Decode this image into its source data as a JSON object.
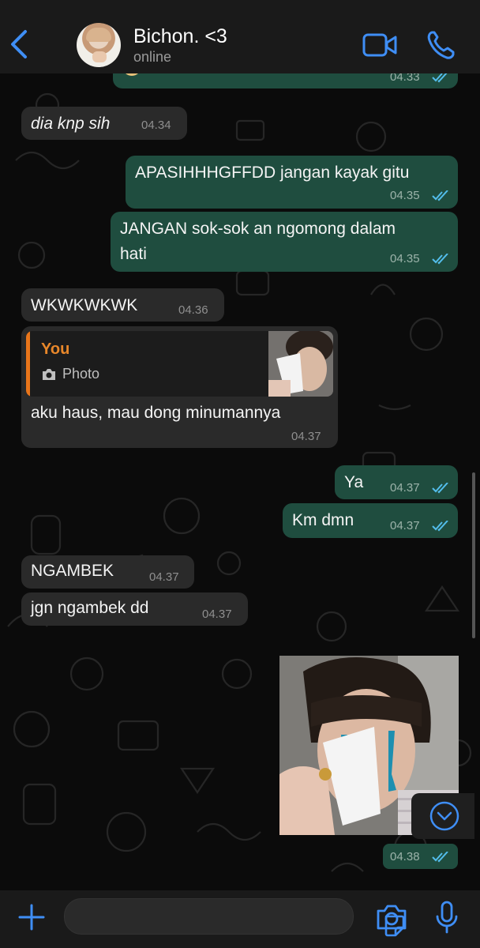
{
  "header": {
    "contact_name": "Bichon. <3",
    "status": "online"
  },
  "messages": [
    {
      "id": "m0",
      "direction": "out",
      "text": "",
      "time": "04.33",
      "read": true
    },
    {
      "id": "m1",
      "direction": "in",
      "text": "dia knp sih",
      "time": "04.34",
      "italic": true
    },
    {
      "id": "m2",
      "direction": "out",
      "text": "APASIHHHGFFDD jangan kayak gitu",
      "time": "04.35",
      "read": true
    },
    {
      "id": "m3",
      "direction": "out",
      "text_line1": "JANGAN sok-sok an ngomong dalam",
      "text_line2": "hati",
      "time": "04.35",
      "read": true
    },
    {
      "id": "m4",
      "direction": "in",
      "text": "WKWKWKWK",
      "time": "04.36"
    },
    {
      "id": "m5",
      "direction": "in",
      "quote_author": "You",
      "quote_label": "Photo",
      "text": "aku haus, mau dong minumannya",
      "time": "04.37"
    },
    {
      "id": "m6",
      "direction": "out",
      "text": "Ya",
      "time": "04.37",
      "read": true
    },
    {
      "id": "m7",
      "direction": "out",
      "text": "Km dmn",
      "time": "04.37",
      "read": true
    },
    {
      "id": "m8",
      "direction": "in",
      "text": "NGAMBEK",
      "time": "04.37"
    },
    {
      "id": "m9",
      "direction": "in",
      "text": "jgn ngambek dd",
      "time": "04.37"
    },
    {
      "id": "m10",
      "direction": "out",
      "type": "photo",
      "time": "04.38",
      "read": true
    }
  ],
  "colors": {
    "accent_blue": "#3f8ef5",
    "incoming_bubble": "#2a2a2a",
    "outgoing_bubble": "#1f4d3f",
    "quote_author": "#e8872a",
    "read_ticks": "#53bdeb"
  },
  "icons": [
    "back-chevron-icon",
    "video-call-icon",
    "voice-call-icon",
    "camera-small-icon",
    "read-ticks-icon",
    "chevron-down-icon",
    "plus-icon",
    "sticker-icon",
    "camera-icon",
    "mic-icon"
  ]
}
